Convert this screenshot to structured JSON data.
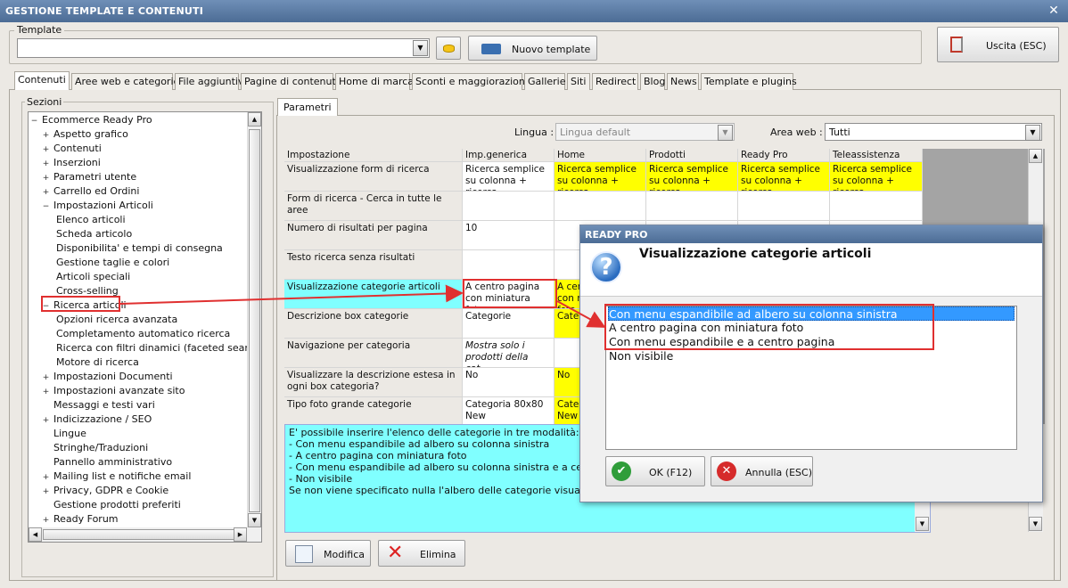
{
  "window": {
    "title": "GESTIONE TEMPLATE E CONTENUTI",
    "close": "✕"
  },
  "template": {
    "label": "Template",
    "value": "",
    "new_button": "Nuovo template",
    "exit_button": "Uscita (ESC)"
  },
  "tabs": [
    "Contenuti",
    "Aree web e categorie",
    "File aggiuntivi",
    "Pagine di contenuti",
    "Home di marca",
    "Sconti e maggiorazioni",
    "Gallerie",
    "Siti",
    "Redirect",
    "Blog",
    "News",
    "Template e plugins"
  ],
  "sections": {
    "label": "Sezioni",
    "tree": [
      {
        "label": "Ecommerce Ready Pro",
        "level": 0,
        "toggle": "−"
      },
      {
        "label": "Aspetto grafico",
        "level": 1,
        "toggle": "+"
      },
      {
        "label": "Contenuti",
        "level": 1,
        "toggle": "+"
      },
      {
        "label": "Inserzioni",
        "level": 1,
        "toggle": "+"
      },
      {
        "label": "Parametri utente",
        "level": 1,
        "toggle": "+"
      },
      {
        "label": "Carrello ed Ordini",
        "level": 1,
        "toggle": "+"
      },
      {
        "label": "Impostazioni Articoli",
        "level": 1,
        "toggle": "−"
      },
      {
        "label": "Elenco articoli",
        "level": 2,
        "toggle": ""
      },
      {
        "label": "Scheda articolo",
        "level": 2,
        "toggle": ""
      },
      {
        "label": "Disponibilita' e tempi di consegna",
        "level": 2,
        "toggle": ""
      },
      {
        "label": "Gestione taglie e colori",
        "level": 2,
        "toggle": ""
      },
      {
        "label": "Articoli speciali",
        "level": 2,
        "toggle": ""
      },
      {
        "label": "Cross-selling",
        "level": 2,
        "toggle": ""
      },
      {
        "label": "Ricerca articoli",
        "level": 1,
        "toggle": "−"
      },
      {
        "label": "Opzioni ricerca avanzata",
        "level": 2,
        "toggle": ""
      },
      {
        "label": "Completamento automatico ricerca",
        "level": 2,
        "toggle": ""
      },
      {
        "label": "Ricerca con filtri dinamici (faceted search)",
        "level": 2,
        "toggle": ""
      },
      {
        "label": "Motore di ricerca",
        "level": 2,
        "toggle": ""
      },
      {
        "label": "Impostazioni Documenti",
        "level": 1,
        "toggle": "+"
      },
      {
        "label": "Impostazioni avanzate sito",
        "level": 1,
        "toggle": "+"
      },
      {
        "label": "Messaggi e testi vari",
        "level": 1,
        "toggle": ""
      },
      {
        "label": "Indicizzazione / SEO",
        "level": 1,
        "toggle": "+"
      },
      {
        "label": "Lingue",
        "level": 1,
        "toggle": ""
      },
      {
        "label": "Stringhe/Traduzioni",
        "level": 1,
        "toggle": ""
      },
      {
        "label": "Pannello amministrativo",
        "level": 1,
        "toggle": ""
      },
      {
        "label": "Mailing list e notifiche email",
        "level": 1,
        "toggle": "+"
      },
      {
        "label": "Privacy, GDPR e Cookie",
        "level": 1,
        "toggle": "+"
      },
      {
        "label": "Gestione prodotti preferiti",
        "level": 1,
        "toggle": ""
      },
      {
        "label": "Ready Forum",
        "level": 1,
        "toggle": "+"
      }
    ]
  },
  "params": {
    "tab": "Parametri",
    "lingua_label": "Lingua :",
    "lingua_value": "Lingua default",
    "area_label": "Area web :",
    "area_value": "Tutti",
    "columns": [
      "Impostazione",
      "Imp.generica",
      "Home",
      "Prodotti",
      "Ready Pro",
      "Teleassistenza"
    ],
    "rows": [
      {
        "name": "Visualizzazione form di ricerca",
        "cells": [
          "Ricerca semplice su colonna + ricerca...",
          "Ricerca semplice su colonna + ricerca...",
          "Ricerca semplice su colonna + ricerca...",
          "Ricerca semplice su colonna + ricerca...",
          "Ricerca semplice su colonna + ricerca..."
        ]
      },
      {
        "name": "Form di ricerca - Cerca in tutte le aree",
        "cells": [
          "",
          "",
          "",
          "",
          ""
        ]
      },
      {
        "name": "Numero di risultati per pagina",
        "cells": [
          "10",
          "",
          "",
          "",
          ""
        ]
      },
      {
        "name": "Testo ricerca senza risultati",
        "cells": [
          "",
          "",
          "",
          "",
          ""
        ]
      },
      {
        "name": "Visualizzazione categorie articoli",
        "cells": [
          "A centro pagina con miniatura foto",
          "A centro pagina con miniatura foto",
          "",
          "",
          ""
        ]
      },
      {
        "name": "Descrizione box categorie",
        "cells": [
          "Categorie",
          "Categorie",
          "",
          "",
          ""
        ]
      },
      {
        "name": "Navigazione per categoria",
        "cells": [
          "Mostra solo i prodotti della cat...",
          "",
          "",
          "",
          ""
        ]
      },
      {
        "name": "Visualizzare la descrizione estesa in ogni box categoria?",
        "cells": [
          "No",
          "No",
          "",
          "",
          ""
        ]
      },
      {
        "name": "Tipo foto grande categorie",
        "cells": [
          "Categoria 80x80 New",
          "Categoria 80x80 New",
          "",
          "",
          ""
        ]
      }
    ],
    "description": [
      "E' possibile inserire l'elenco delle categorie in tre modalità:",
      "- Con menu espandibile ad albero su colonna sinistra",
      "- A centro pagina con miniatura foto",
      "- Con menu espandibile ad albero su colonna sinistra e a centro pagina",
      "- Non visibile",
      "Se non viene specificato nulla l'albero delle categorie visualizzato"
    ],
    "edit_button": "Modifica",
    "delete_button": "Elimina"
  },
  "dialog": {
    "title": "READY PRO",
    "heading": "Visualizzazione categorie articoli",
    "options": [
      "Con menu espandibile ad albero su colonna sinistra",
      "A centro pagina con miniatura foto",
      "Con menu espandibile e a centro pagina",
      "Non visibile"
    ],
    "selected_index": 0,
    "ok_button": "OK (F12)",
    "cancel_button": "Annulla (ESC)"
  },
  "colors": {
    "title_bar": "#5a7aa3",
    "highlight_cyan": "#80ffff",
    "override_yellow": "#ffff00",
    "selection": "#3399ff",
    "annotation_red": "#e03030"
  }
}
